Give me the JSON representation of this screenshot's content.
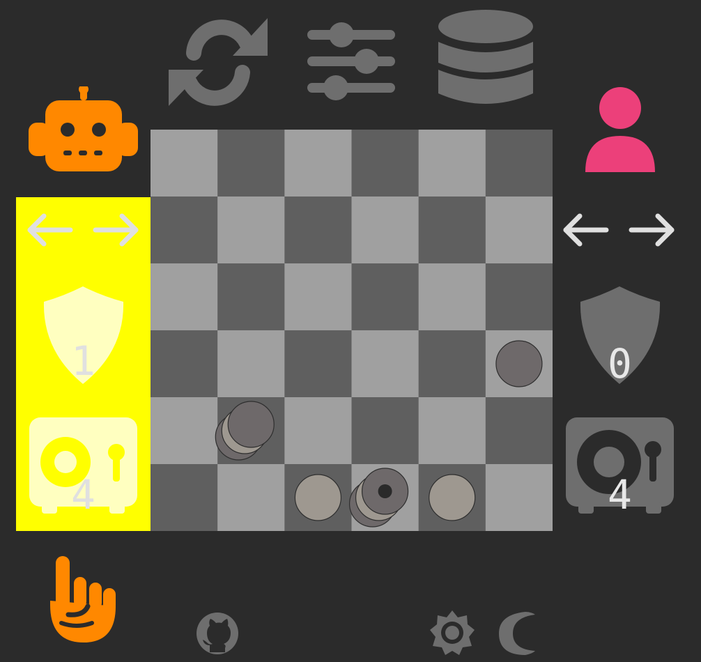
{
  "colors": {
    "background": "#2b2b2b",
    "square_light": "#a0a0a0",
    "square_dark": "#5f5f5f",
    "robot_orange": "#ff8800",
    "human_pink": "#ec407a",
    "active_panel_yellow": "#ffff00",
    "icon_gray": "#6e6e6e",
    "arrow_light": "#e0e0e0",
    "piece_light": "#9e9890",
    "piece_dark": "#6e696a"
  },
  "toolbar": {
    "icons": [
      "refresh-icon",
      "sliders-icon",
      "database-icon"
    ]
  },
  "players": {
    "left": {
      "type": "robot",
      "active": true,
      "shield_count": "1",
      "safe_count": "4"
    },
    "right": {
      "type": "human",
      "active": false,
      "shield_count": "0",
      "safe_count": "4"
    }
  },
  "board": {
    "rows": 6,
    "cols": 6,
    "pieces": [
      {
        "row": 3,
        "col": 5,
        "color": "dark",
        "stack": 1,
        "marked": false
      },
      {
        "row": 4,
        "col": 1,
        "color": "dark",
        "stack": 3,
        "marked": false
      },
      {
        "row": 5,
        "col": 2,
        "color": "light",
        "stack": 1,
        "marked": false
      },
      {
        "row": 5,
        "col": 3,
        "color": "dark",
        "stack": 3,
        "marked": true
      },
      {
        "row": 5,
        "col": 4,
        "color": "light",
        "stack": 1,
        "marked": false
      }
    ]
  },
  "footer": {
    "icons": [
      "hand-pointer-icon",
      "github-icon",
      "settings-icon",
      "dark-mode-icon"
    ]
  }
}
